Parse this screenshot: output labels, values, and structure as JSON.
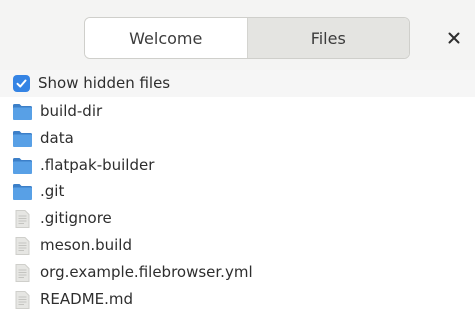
{
  "header": {
    "tabs": [
      {
        "label": "Welcome",
        "active": false
      },
      {
        "label": "Files",
        "active": true
      }
    ],
    "close_icon": "close-icon"
  },
  "options": {
    "show_hidden": {
      "label": "Show hidden files",
      "checked": true
    }
  },
  "files": [
    {
      "name": "build-dir",
      "type": "folder"
    },
    {
      "name": "data",
      "type": "folder"
    },
    {
      "name": ".flatpak-builder",
      "type": "folder"
    },
    {
      "name": ".git",
      "type": "folder"
    },
    {
      "name": ".gitignore",
      "type": "file"
    },
    {
      "name": "meson.build",
      "type": "file"
    },
    {
      "name": "org.example.filebrowser.yml",
      "type": "file"
    },
    {
      "name": "README.md",
      "type": "file"
    }
  ],
  "colors": {
    "accent": "#3584e4",
    "folder": "#4a90d9",
    "file": "#d8d8d6"
  }
}
